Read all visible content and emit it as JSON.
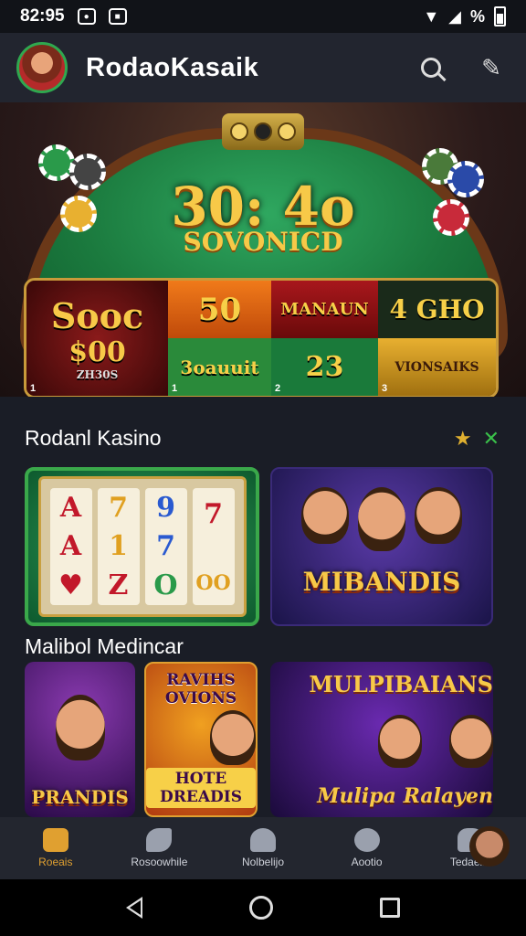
{
  "status_bar": {
    "time": "82:95",
    "right_text": "%"
  },
  "app_bar": {
    "title": "RodaoKasaik"
  },
  "hero": {
    "title": "30: 4o",
    "subtitle": "SOVONICD",
    "grid": {
      "main_big": "Sooc",
      "main_mid": "$00",
      "main_small": "ZH30S",
      "c1": "50",
      "c2": "MANAUN",
      "c3": "4 GHO",
      "c4": "3oauuit",
      "c5": "23",
      "c6": "VIONSAIKS",
      "n1": "1",
      "n2": "2",
      "n3": "3"
    }
  },
  "section1": {
    "title": "Rodanl Kasino"
  },
  "section2": {
    "title": "Malibol Medincar"
  },
  "slot_reels": [
    [
      "A",
      "A",
      "♥"
    ],
    [
      "7",
      "1",
      "Z"
    ],
    [
      "9",
      "7",
      "O"
    ],
    [
      "7",
      "",
      "OO"
    ]
  ],
  "tiles": {
    "heroes_caption": "MIBANDIS",
    "paradise_caption": "PRANDIS",
    "dreams_top": "RAVIHS OVIONS",
    "dreams_bottom": "HOTE DREADIS",
    "multi_top": "MULPIBAIANS",
    "multi_bottom": "Mulipa Ralayen"
  },
  "bottom_nav": [
    {
      "label": "Roeais"
    },
    {
      "label": "Rosoowhile"
    },
    {
      "label": "Nolbelijo"
    },
    {
      "label": "Aootio"
    },
    {
      "label": "Tedaelio"
    }
  ],
  "colors": {
    "accent": "#e0a030",
    "felt": "#1b7a3e",
    "brand_green": "#3ac04a"
  }
}
